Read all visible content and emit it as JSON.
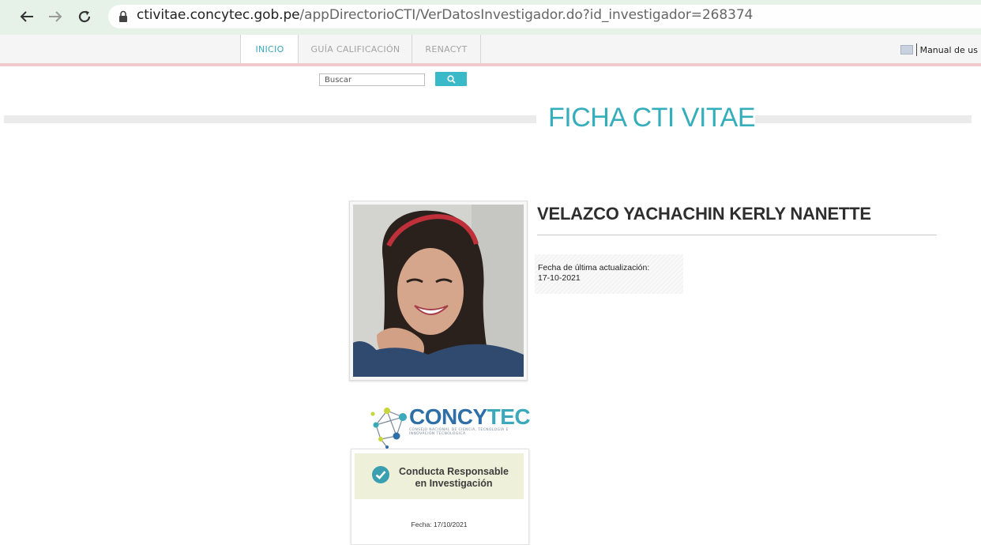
{
  "browser": {
    "url_host": "ctivitae.concytec.gob.pe",
    "url_path": "/appDirectorioCTI/VerDatosInvestigador.do?id_investigador=268374"
  },
  "nav": {
    "items": [
      {
        "label": "INICIO",
        "active": true
      },
      {
        "label": "GUÍA CALIFICACIÓN",
        "active": false
      },
      {
        "label": "RENACYT",
        "active": false
      }
    ],
    "manual_label": "Manual de us"
  },
  "search": {
    "placeholder": "Buscar"
  },
  "page_title": "FICHA CTI VITAE",
  "researcher": {
    "name": "VELAZCO YACHACHIN KERLY NANETTE",
    "update_label": "Fecha de última actualización:",
    "update_date": "17-10-2021"
  },
  "logo": {
    "word_part1": "CONCY",
    "word_part2": "TEC",
    "subtitle": "CONSEJO NACIONAL DE CIENCIA, TECNOLOGÍA E INNOVACIÓN TECNOLÓGICA"
  },
  "badge": {
    "line1": "Conducta Responsable",
    "line2": "en Investigación",
    "date": "Fecha: 17/10/2021"
  },
  "colors": {
    "accent": "#35aebb",
    "browser_bar": "#e6f2e8",
    "nav_border": "#f0c9cd",
    "badge_bg": "#eef0d9"
  }
}
